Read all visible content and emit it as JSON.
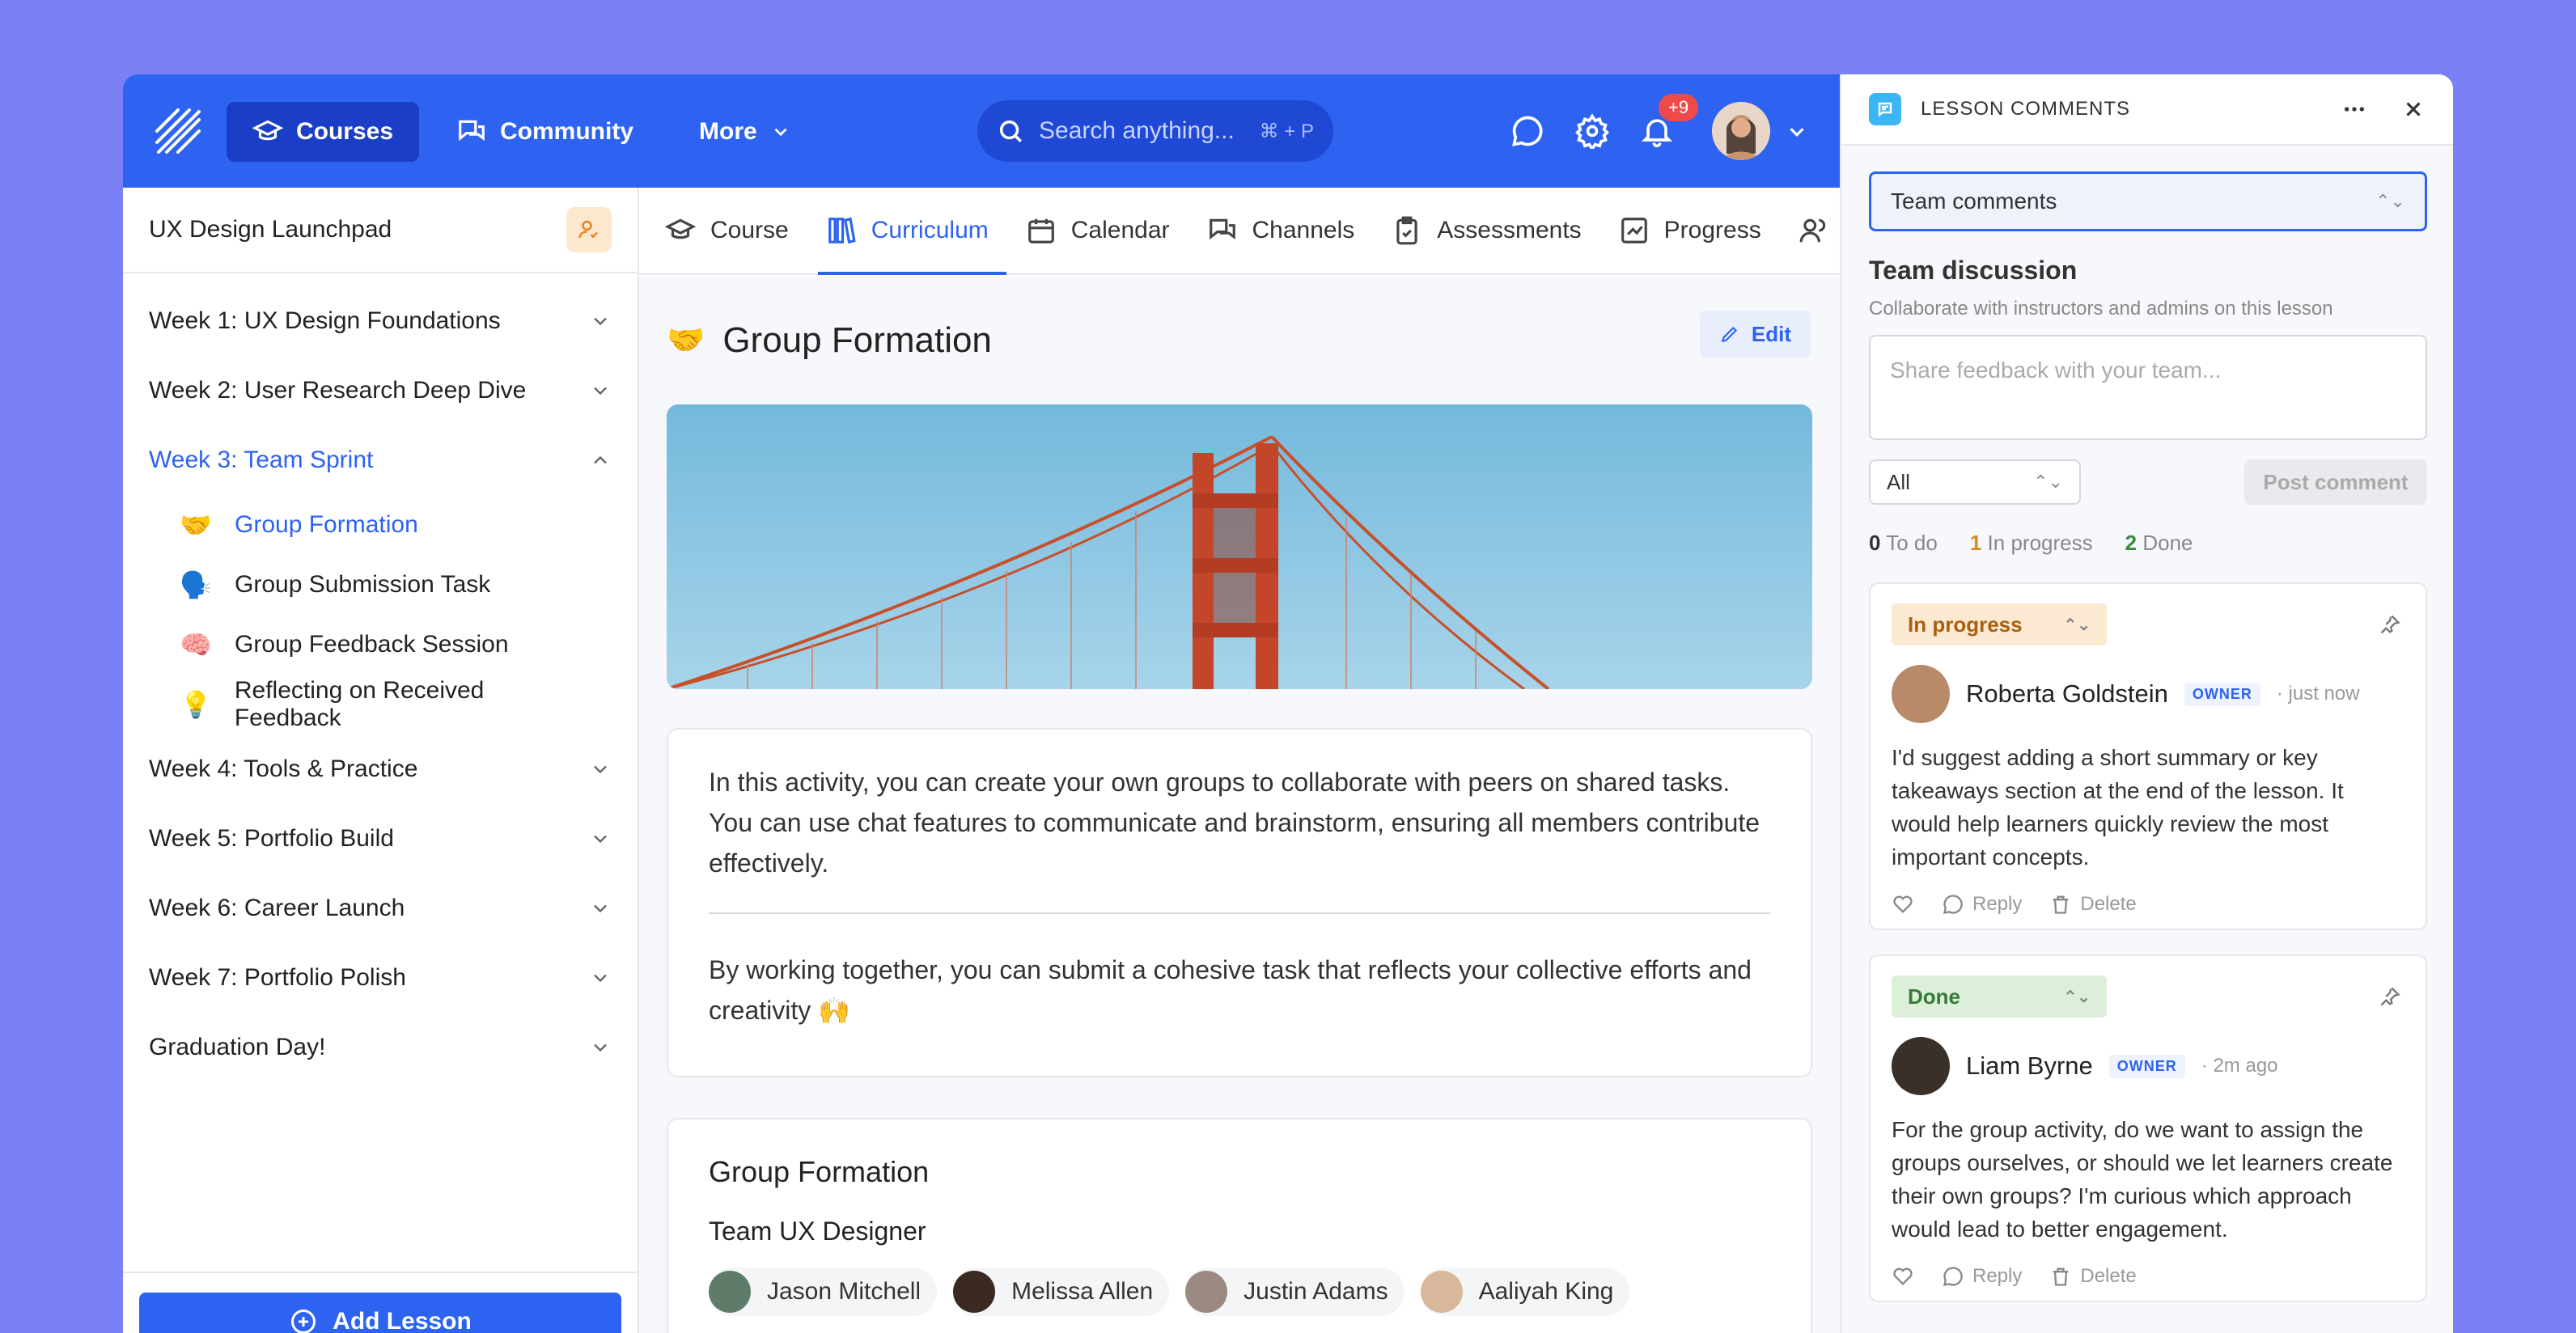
{
  "topbar": {
    "nav_courses": "Courses",
    "nav_community": "Community",
    "nav_more": "More",
    "search_placeholder": "Search anything...",
    "search_kbd": "⌘ + P",
    "notif_badge": "+9"
  },
  "sidebar": {
    "course_title": "UX Design Launchpad",
    "weeks": [
      {
        "label": "Week 1: UX Design Foundations"
      },
      {
        "label": "Week 2: User Research Deep Dive"
      },
      {
        "label": "Week 3: Team Sprint"
      },
      {
        "label": "Week 4: Tools & Practice"
      },
      {
        "label": "Week 5: Portfolio Build"
      },
      {
        "label": "Week 6: Career Launch"
      },
      {
        "label": "Week 7: Portfolio Polish"
      },
      {
        "label": "Graduation Day!"
      }
    ],
    "lessons": [
      {
        "emoji": "🤝",
        "label": "Group Formation"
      },
      {
        "emoji": "🗣️",
        "label": "Group Submission Task"
      },
      {
        "emoji": "🧠",
        "label": "Group Feedback Session"
      },
      {
        "emoji": "💡",
        "label": "Reflecting on Received Feedback"
      }
    ],
    "add_lesson": "Add Lesson"
  },
  "tabs": [
    "Course",
    "Curriculum",
    "Calendar",
    "Channels",
    "Assessments",
    "Progress"
  ],
  "main": {
    "title_emoji": "🤝",
    "title": "Group Formation",
    "edit": "Edit",
    "para1": "In this activity, you can create your own groups to collaborate with peers on shared tasks. You can use chat features to communicate and brainstorm, ensuring all members contribute effectively.",
    "para2": "By working together, you can submit a cohesive task that reflects your collective efforts and creativity 🙌",
    "group_title": "Group Formation",
    "team_name": "Team UX Designer",
    "members": [
      "Jason Mitchell",
      "Melissa Allen",
      "Justin Adams",
      "Aaliyah King"
    ]
  },
  "panel": {
    "header": "LESSON COMMENTS",
    "select": "Team comments",
    "title": "Team discussion",
    "subtitle": "Collaborate with instructors and admins on this lesson",
    "placeholder": "Share feedback with your team...",
    "filter": "All",
    "post": "Post comment",
    "counts": {
      "todo_n": "0",
      "todo": "To do",
      "prog_n": "1",
      "prog": "In progress",
      "done_n": "2",
      "done": "Done"
    },
    "comments": [
      {
        "status": "In progress",
        "name": "Roberta Goldstein",
        "role": "OWNER",
        "time": "· just now",
        "text": "I'd suggest adding a short summary or key takeaways section at the end of the lesson. It would help learners quickly review the most important concepts.",
        "reply": "Reply",
        "delete": "Delete"
      },
      {
        "status": "Done",
        "name": "Liam Byrne",
        "role": "OWNER",
        "time": "· 2m ago",
        "text": "For the group activity, do we want to assign the groups ourselves, or should we let learners create their own groups? I'm curious which approach would lead to better engagement.",
        "reply": "Reply",
        "delete": "Delete"
      }
    ]
  }
}
